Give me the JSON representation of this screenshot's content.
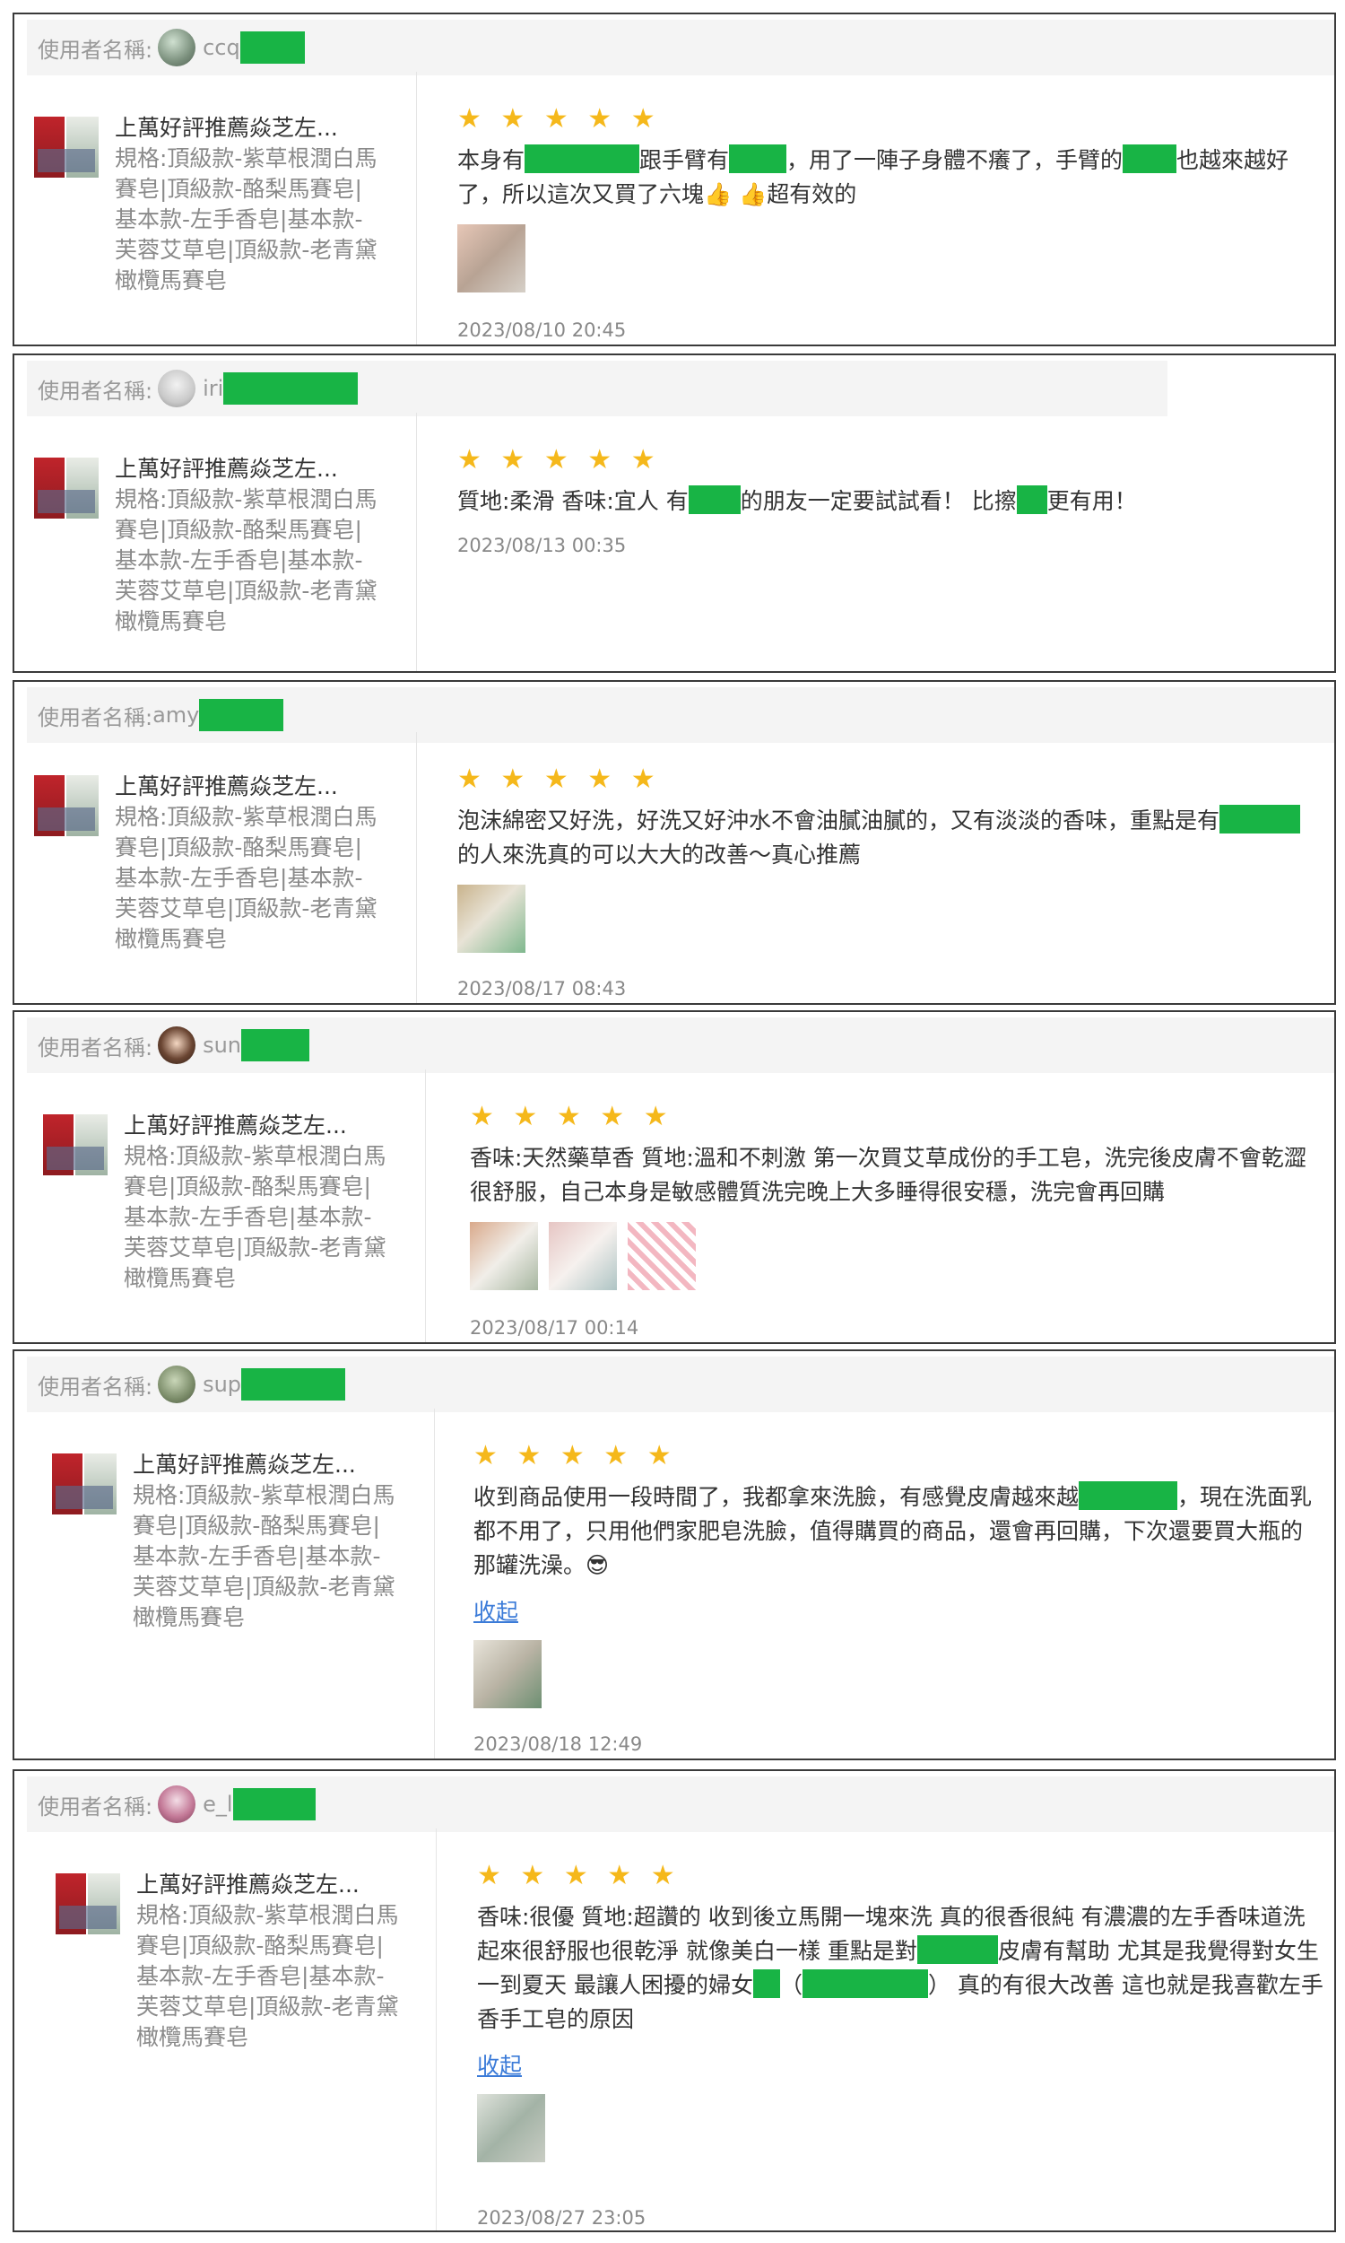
{
  "username_prefix": "使用者名稱:",
  "product": {
    "title": "上萬好評推薦焱芝左...",
    "spec": "規格:頂級款-紫草根潤白馬賽皂|頂級款-酪梨馬賽皂|基本款-左手香皂|基本款-芙蓉艾草皂|頂級款-老青黛橄欖馬賽皂"
  },
  "stars": "★ ★ ★ ★ ★",
  "reviews": [
    {
      "username": "ccq",
      "text_parts": [
        "本身有",
        "跟手臂有",
        "，用了一陣子身體不癢了，手臂的",
        "也越來越好了，所以這次又買了六塊",
        "超有效的"
      ],
      "emoji": "👍 👍",
      "date": "2023/08/10 20:45"
    },
    {
      "username": "iri",
      "text_parts": [
        "質地:柔滑 香味:宜人 有",
        "的朋友一定要試試看！ 比擦",
        "更有用！"
      ],
      "date": "2023/08/13 00:35"
    },
    {
      "username": "amy",
      "text_parts": [
        "泡沫綿密又好洗，好洗又好沖水不會油膩油膩的，又有淡淡的香味，重點是有",
        "的人來洗真的可以大大的改善～真心推薦"
      ],
      "date": "2023/08/17 08:43"
    },
    {
      "username": "sun",
      "text": "香味:天然藥草香 質地:溫和不刺激 第一次買艾草成份的手工皂，洗完後皮膚不會乾澀很舒服，自己本身是敏感體質洗完晚上大多睡得很安穩，洗完會再回購",
      "date": "2023/08/17 00:14"
    },
    {
      "username": "sup",
      "text_parts": [
        "收到商品使用一段時間了，我都拿來洗臉，有感覺皮膚越來越",
        "，現在洗面乳都不用了，只用他們家肥皂洗臉，值得購買的商品，還會再回購，下次還要買大瓶的那罐洗澡。"
      ],
      "emoji": "😎",
      "collapse": "收起",
      "date": "2023/08/18 12:49"
    },
    {
      "username": "e_l",
      "text_parts": [
        "香味:很優 質地:超讚的 收到後立馬開一塊來洗 真的很香很純 有濃濃的左手香味道洗起來很舒服也很乾淨 就像美白一樣 重點是對",
        "皮膚有幫助 尤其是我覺得對女生一到夏天 最讓人困擾的婦女",
        "（",
        "） 真的有很大改善 這也就是我喜歡左手香手工皂的原因"
      ],
      "collapse": "收起",
      "date": "2023/08/27 23:05"
    }
  ]
}
